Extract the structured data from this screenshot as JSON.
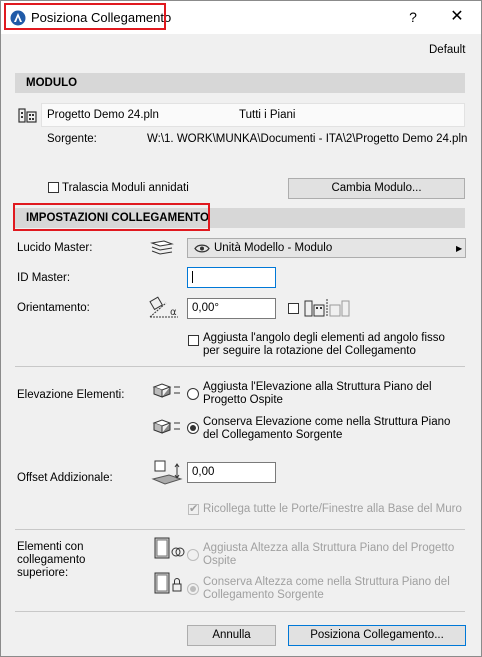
{
  "window": {
    "title": "Posiziona Collegamento",
    "help": "?",
    "close": "✕",
    "profile": "Default"
  },
  "modulo": {
    "header": "MODULO",
    "file_name": "Progetto Demo 24.pln",
    "floors": "Tutti i Piani",
    "source_label": "Sorgente:",
    "source_path": "W:\\1. WORK\\MUNKA\\Documenti - ITA\\2\\Progetto Demo 24.pln",
    "skip_nested_label": "Tralascia Moduli annidati",
    "change_module_button": "Cambia Modulo..."
  },
  "impostazioni": {
    "header": "IMPOSTAZIONI COLLEGAMENTO",
    "master_layer_label": "Lucido Master:",
    "master_layer_value": "Unità Modello - Modulo",
    "master_id_label": "ID Master:",
    "master_id_value": "",
    "orientation_label": "Orientamento:",
    "orientation_value": "0,00°",
    "adjust_angle_label": "Aggiusta l'angolo degli elementi ad angolo fisso per seguire la rotazione del Collegamento"
  },
  "elevazione": {
    "label": "Elevazione Elementi:",
    "option_adjust": "Aggiusta l'Elevazione alla Struttura Piano del Progetto Ospite",
    "option_keep": "Conserva Elevazione come nella Struttura Piano del Collegamento Sorgente",
    "selected": "keep"
  },
  "offset": {
    "label": "Offset Addizionale:",
    "value": "0,00"
  },
  "reconnect": {
    "label": "Ricollega tutte le Porte/Finestre alla Base del Muro",
    "checked": true,
    "disabled": true
  },
  "top_linked": {
    "label": "Elementi con collegamento superiore:",
    "option_adjust": "Aggiusta Altezza alla Struttura Piano del Progetto Ospite",
    "option_keep": "Conserva Altezza come nella Struttura Piano del Collegamento Sorgente",
    "selected": "keep",
    "disabled": true
  },
  "footer": {
    "cancel_button": "Annulla",
    "place_button": "Posiziona Collegamento..."
  },
  "colors": {
    "highlight": "#e0191f",
    "section_bg": "#d7d7d7",
    "dialog_bg": "#f0f0f0",
    "focus_border": "#0078d7"
  }
}
